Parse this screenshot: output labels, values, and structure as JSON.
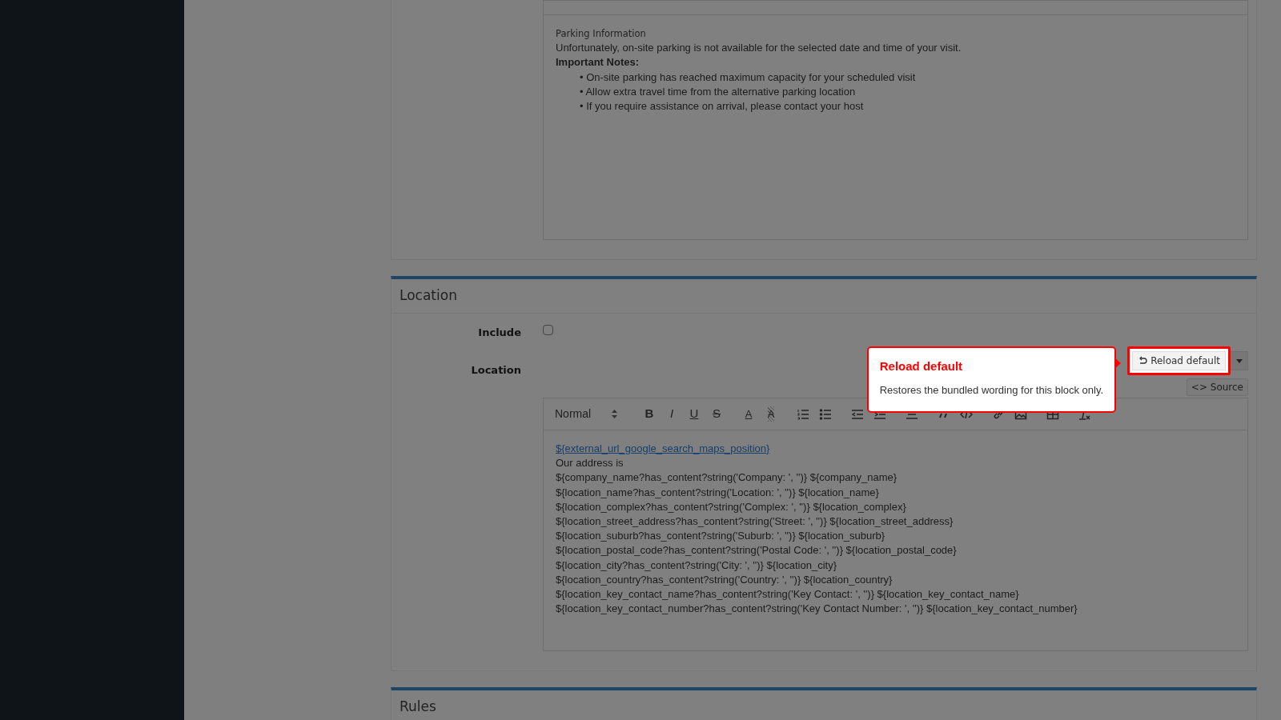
{
  "top_editor": {
    "lines": [
      {
        "kind": "caption",
        "text": "Parking Information"
      },
      {
        "kind": "paragraph",
        "text": "Unfortunately, on-site parking is not available for the selected date and time of your visit."
      },
      {
        "kind": "heading",
        "text": "Important Notes:"
      },
      {
        "kind": "bullet",
        "bullet": "•",
        "text": "On-site parking has reached maximum capacity for your scheduled visit"
      },
      {
        "kind": "bullet",
        "bullet": "•",
        "text": "Allow extra travel time from the alternative parking location"
      },
      {
        "kind": "bullet",
        "bullet": "•",
        "text": "If you require assistance on arrival, please contact your host"
      }
    ]
  },
  "location_section": {
    "title": "Location",
    "include": {
      "label": "Include",
      "checked": false
    },
    "location_label": "Location",
    "reload_button": {
      "label": "Reload default",
      "highlighted": true
    },
    "source_button": "<> Source",
    "toolbar": {
      "format": "Normal",
      "items": [
        {
          "kind": "bold",
          "label": "B"
        },
        {
          "kind": "italic",
          "label": "I"
        },
        {
          "kind": "underline",
          "label": "U"
        },
        {
          "kind": "strike",
          "label": "S"
        },
        {
          "kind": "color",
          "label": "A"
        },
        {
          "kind": "background",
          "label": "A"
        },
        {
          "kind": "ordered-list"
        },
        {
          "kind": "bullet-list"
        },
        {
          "kind": "outdent"
        },
        {
          "kind": "indent"
        },
        {
          "kind": "align"
        },
        {
          "kind": "blockquote"
        },
        {
          "kind": "code"
        },
        {
          "kind": "link"
        },
        {
          "kind": "image"
        },
        {
          "kind": "table"
        },
        {
          "kind": "clear-format"
        }
      ]
    },
    "lines": [
      {
        "kind": "link",
        "text": "${external_url_google_search_maps_position}"
      },
      {
        "kind": "paragraph",
        "text": "Our address is"
      },
      {
        "kind": "paragraph",
        "text": "${company_name?has_content?string('Company: ', '')} ${company_name}"
      },
      {
        "kind": "paragraph",
        "text": "${location_name?has_content?string('Location: ', '')} ${location_name}"
      },
      {
        "kind": "paragraph",
        "text": "${location_complex?has_content?string('Complex: ', '')} ${location_complex}"
      },
      {
        "kind": "paragraph",
        "text": "${location_street_address?has_content?string('Street: ', '')} ${location_street_address}"
      },
      {
        "kind": "paragraph",
        "text": "${location_suburb?has_content?string('Suburb: ', '')} ${location_suburb}"
      },
      {
        "kind": "paragraph",
        "text": "${location_postal_code?has_content?string('Postal Code: ', '')} ${location_postal_code}"
      },
      {
        "kind": "paragraph",
        "text": "${location_city?has_content?string('City: ', '')} ${location_city}"
      },
      {
        "kind": "paragraph",
        "text": "${location_country?has_content?string('Country: ', '')} ${location_country}"
      },
      {
        "kind": "paragraph",
        "text": "${location_key_contact_name?has_content?string('Key Contact: ', '')} ${location_key_contact_name}"
      },
      {
        "kind": "paragraph",
        "text": "${location_key_contact_number?has_content?string('Key Contact Number: ', '')} ${location_key_contact_number}"
      }
    ]
  },
  "tour_popover": {
    "title": "Reload default",
    "text": "Restores the bundled wording for this block only."
  },
  "next_section": {
    "title": "Rules"
  }
}
